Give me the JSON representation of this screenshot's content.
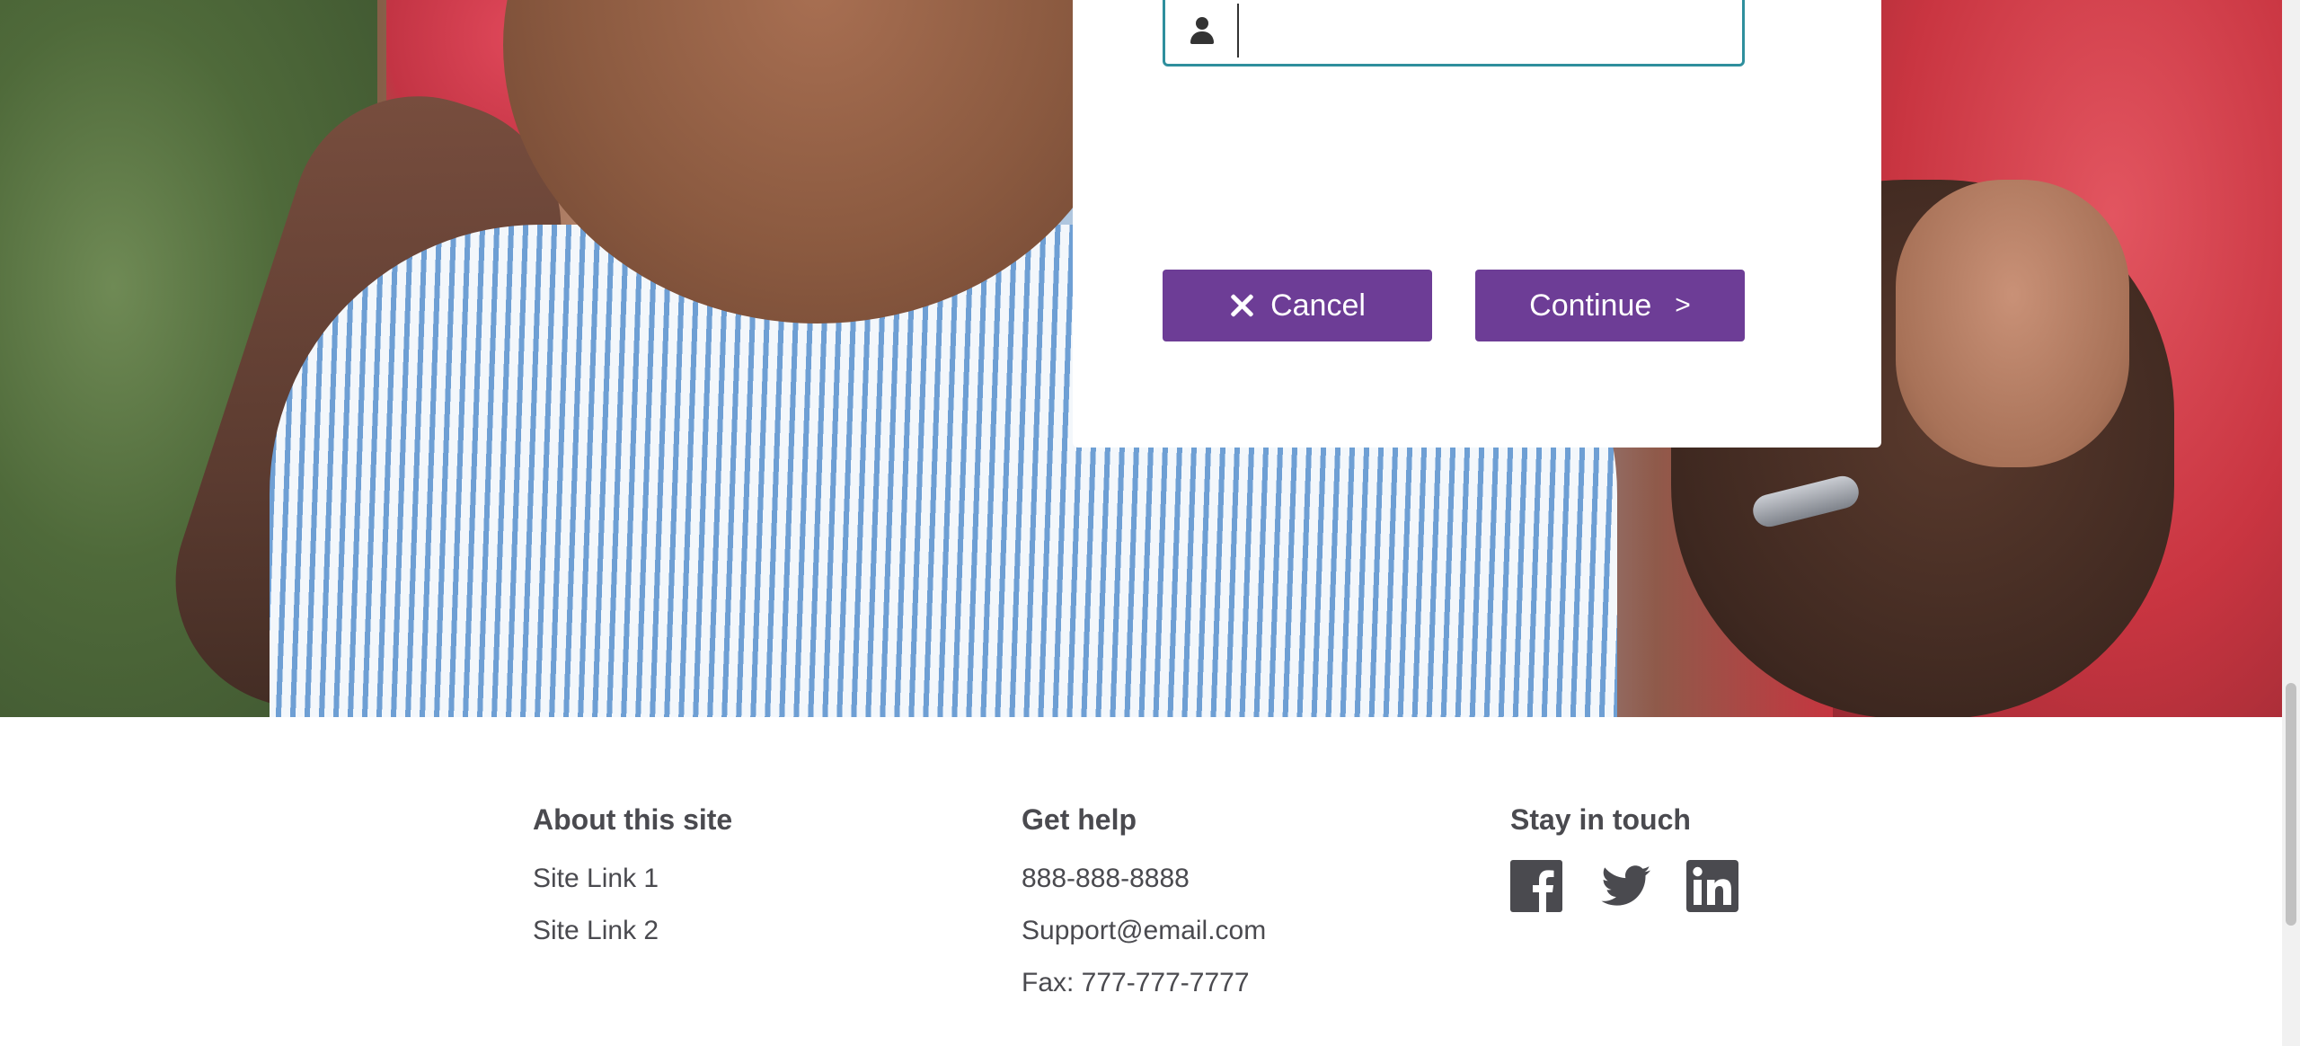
{
  "login": {
    "username_value": "",
    "username_placeholder": "",
    "cancel_label": "Cancel",
    "continue_label": "Continue",
    "continue_chevron": ">"
  },
  "footer": {
    "about": {
      "heading": "About this site",
      "links": [
        "Site Link 1",
        "Site Link 2"
      ]
    },
    "help": {
      "heading": "Get help",
      "phone": "888-888-8888",
      "email": "Support@email.com",
      "fax": "Fax: 777-777-7777"
    },
    "social": {
      "heading": "Stay in touch",
      "icons": [
        "facebook-icon",
        "twitter-icon",
        "linkedin-icon"
      ]
    }
  },
  "colors": {
    "primary_button": "#6d3d96",
    "input_focus_border": "#2f8f9d",
    "footer_text": "#4a4a4f"
  }
}
